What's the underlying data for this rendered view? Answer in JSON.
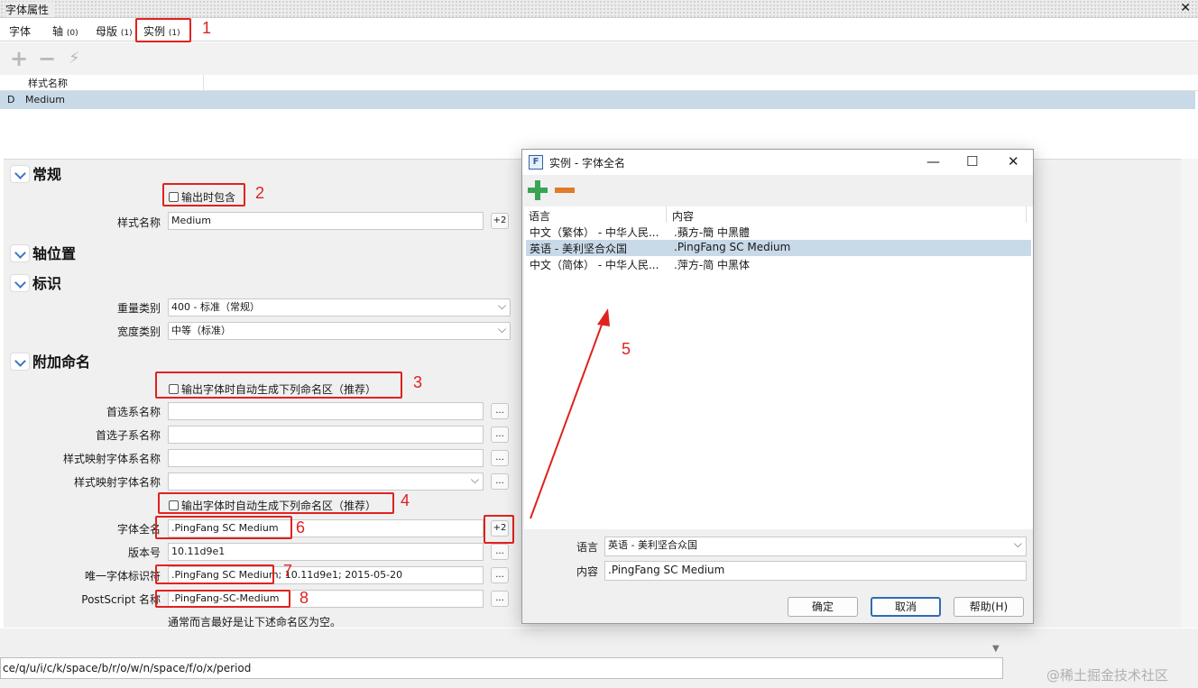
{
  "window": {
    "title": "字体属性",
    "close": "✕"
  },
  "tabs": [
    {
      "label": "字体",
      "count": ""
    },
    {
      "label": "轴",
      "count": "(0)"
    },
    {
      "label": "母版",
      "count": "(1)"
    },
    {
      "label": "实例",
      "count": "(1)"
    }
  ],
  "toolbar": {
    "add": "+",
    "remove": "−",
    "action": "⚡"
  },
  "instance_list": {
    "header": "样式名称",
    "rows": [
      {
        "marker": "D",
        "name": "Medium"
      }
    ]
  },
  "sections": {
    "general": "常规",
    "axis": "轴位置",
    "identity": "标识",
    "naming": "附加命名"
  },
  "general": {
    "include_checkbox": "输出时包含",
    "style_name_label": "样式名称",
    "style_name_value": "Medium",
    "style_name_plus": "+2"
  },
  "identity": {
    "weight_label": "重量类别",
    "weight_value": "400 - 标准（常规）",
    "width_label": "宽度类别",
    "width_value": "中等（标准）"
  },
  "naming": {
    "auto_checkbox_1": "输出字体时自动生成下列命名区（推荐）",
    "pref_family_label": "首选系名称",
    "pref_subfamily_label": "首选子系名称",
    "stylemap_family_label": "样式映射字体系名称",
    "stylemap_style_label": "样式映射字体名称",
    "auto_checkbox_2": "输出字体时自动生成下列命名区（推荐）",
    "fullname_label": "字体全名",
    "fullname_value": ".PingFang SC Medium",
    "fullname_plus": "+2",
    "version_label": "版本号",
    "version_value": "10.11d9e1",
    "uniqueid_label": "唯一字体标识符",
    "uniqueid_value": ".PingFang SC Medium; 10.11d9e1; 2015-05-20",
    "postscript_label": "PostScript 名称",
    "postscript_value": ".PingFang-SC-Medium",
    "note": "通常而言最好是让下述命名区为空。",
    "dots": "..."
  },
  "annotations": [
    "1",
    "2",
    "3",
    "4",
    "5",
    "6",
    "7",
    "8"
  ],
  "command_line": "ce/q/u/i/c/k/space/b/r/o/w/n/space/f/o/x/period",
  "watermark": "@稀土掘金技术社区",
  "dialog": {
    "title": "实例 - 字体全名",
    "app_icon": "F",
    "min": "—",
    "max": "☐",
    "close": "✕",
    "col_language": "语言",
    "col_content": "内容",
    "rows": [
      {
        "language": "中文（繁体） - 中华人民...",
        "content": ".蘋方-簡 中黑體"
      },
      {
        "language": "英语 - 美利坚合众国",
        "content": ".PingFang SC Medium"
      },
      {
        "language": "中文（简体） - 中华人民...",
        "content": ".萍方-简 中黑体"
      }
    ],
    "language_label": "语言",
    "language_value": "英语 - 美利坚合众国",
    "content_label": "内容",
    "content_value": ".PingFang SC Medium",
    "ok": "确定",
    "cancel": "取消",
    "help": "帮助(H)"
  },
  "colors": {
    "accent_red": "#e0221e",
    "selection": "#c8d9e8",
    "plus_green": "#3aa354",
    "minus_orange": "#e07b2a"
  }
}
